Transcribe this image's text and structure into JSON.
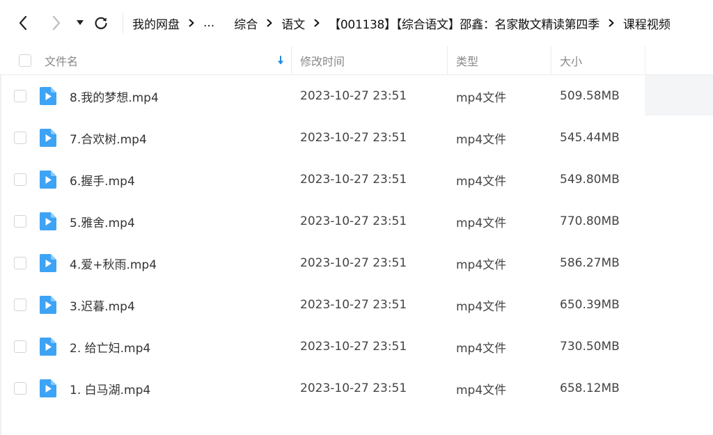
{
  "toolbar": {
    "back_icon": "chevron-left-icon",
    "forward_icon": "chevron-right-icon",
    "history_icon": "caret-down-icon",
    "refresh_icon": "refresh-icon"
  },
  "breadcrumb": {
    "items": [
      {
        "label": "我的网盘"
      },
      {
        "label": "..."
      },
      {
        "label": "综合"
      },
      {
        "label": "语文"
      },
      {
        "label": "【001138】【综合语文】邵鑫：名家散文精读第四季"
      },
      {
        "label": "课程视频"
      }
    ],
    "separator_icon": "chevron-right-icon"
  },
  "table": {
    "headers": {
      "name": "文件名",
      "modified": "修改时间",
      "type": "类型",
      "size": "大小"
    },
    "sort_icon": "sort-down-arrow-icon",
    "accent_color": "#1e88e5",
    "file_icon_color": "#3da3f5",
    "rows": [
      {
        "name": "8.我的梦想.mp4",
        "modified": "2023-10-27 23:51",
        "type": "mp4文件",
        "size": "509.58MB"
      },
      {
        "name": "7.合欢树.mp4",
        "modified": "2023-10-27 23:51",
        "type": "mp4文件",
        "size": "545.44MB"
      },
      {
        "name": "6.握手.mp4",
        "modified": "2023-10-27 23:51",
        "type": "mp4文件",
        "size": "549.80MB"
      },
      {
        "name": "5.雅舍.mp4",
        "modified": "2023-10-27 23:51",
        "type": "mp4文件",
        "size": "770.80MB"
      },
      {
        "name": "4.爱+秋雨.mp4",
        "modified": "2023-10-27 23:51",
        "type": "mp4文件",
        "size": "586.27MB"
      },
      {
        "name": "3.迟暮.mp4",
        "modified": "2023-10-27 23:51",
        "type": "mp4文件",
        "size": "650.39MB"
      },
      {
        "name": "2. 给亡妇.mp4",
        "modified": "2023-10-27 23:51",
        "type": "mp4文件",
        "size": "730.50MB"
      },
      {
        "name": "1. 白马湖.mp4",
        "modified": "2023-10-27 23:51",
        "type": "mp4文件",
        "size": "658.12MB"
      }
    ]
  }
}
